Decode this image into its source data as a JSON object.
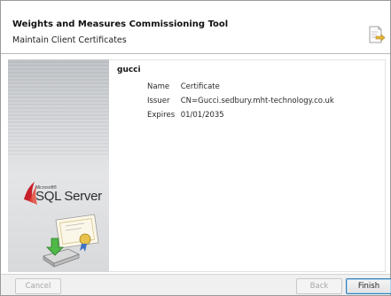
{
  "header": {
    "title": "Weights and Measures Commissioning Tool",
    "subtitle": "Maintain Client Certificates",
    "icon": "certificate-export-icon"
  },
  "side_panel": {
    "logo_small": "Microsoft®",
    "logo_text": "SQL Server",
    "graphic_icon": "certificate-install-icon"
  },
  "certificate": {
    "name": "gucci",
    "fields": [
      {
        "label": "Name",
        "value": "Certificate"
      },
      {
        "label": "Issuer",
        "value": "CN=Gucci.sedbury.mht-technology.co.uk"
      },
      {
        "label": "Expires",
        "value": "01/01/2035"
      }
    ]
  },
  "buttons": {
    "cancel": "Cancel",
    "back": "Back",
    "finish": "Finish"
  },
  "colors": {
    "panel_gradient_top": "#bfc2c6",
    "panel_gradient_bottom": "#e4e5e7",
    "finish_border": "#3c7fb1"
  }
}
